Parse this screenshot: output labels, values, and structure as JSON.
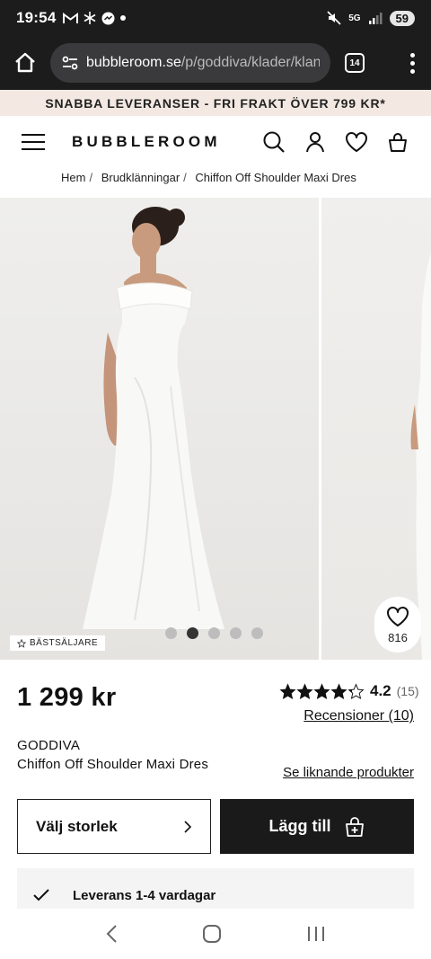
{
  "status_bar": {
    "time": "19:54",
    "network": "5G",
    "battery": "59"
  },
  "browser": {
    "url_host": "bubbleroom.se",
    "url_path": "/p/goddiva/klader/klannir",
    "tab_count": "14"
  },
  "promo": {
    "text": "SNABBA LEVERANSER - FRI FRAKT ÖVER 799 KR*"
  },
  "header": {
    "logo": "BUBBLEROOM"
  },
  "breadcrumb": [
    "Hem",
    "Brudklänningar",
    "Chiffon Off Shoulder Maxi Dres"
  ],
  "gallery": {
    "badge": "BÄSTSÄLJARE",
    "favorites_count": "816",
    "image_count": 5,
    "active_index": 1
  },
  "product": {
    "price": "1 299 kr",
    "rating": "4.2",
    "rating_value": 4.2,
    "rating_count": "(15)",
    "reviews_link": "Recensioner (10)",
    "brand": "GODDIVA",
    "name": "Chiffon Off Shoulder Maxi Dres",
    "similar_link": "Se liknande produkter"
  },
  "actions": {
    "size_label": "Välj storlek",
    "add_label": "Lägg till"
  },
  "delivery": {
    "text": "Leverans 1-4 vardagar"
  },
  "colors": {
    "promo_bg": "#f3e8e2",
    "button_dark": "#1a1a1a",
    "chrome_bg": "#1c1c1c"
  }
}
